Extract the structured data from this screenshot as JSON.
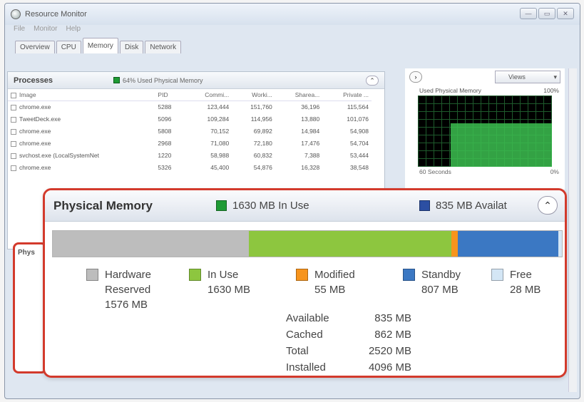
{
  "window": {
    "title": "Resource Monitor",
    "btn_min": "—",
    "btn_max": "▭",
    "btn_close": "✕"
  },
  "menu": [
    "File",
    "Monitor",
    "Help"
  ],
  "tabs": [
    "Overview",
    "CPU",
    "Memory",
    "Disk",
    "Network"
  ],
  "active_tab": "Memory",
  "processes": {
    "title": "Processes",
    "summary": "64% Used Physical Memory",
    "columns": [
      "Image",
      "PID",
      "Commi...",
      "Worki...",
      "Sharea...",
      "Private ..."
    ],
    "rows": [
      [
        "chrome.exe",
        "5288",
        "123,444",
        "151,760",
        "36,196",
        "115,564"
      ],
      [
        "TweetDeck.exe",
        "5096",
        "109,284",
        "114,956",
        "13,880",
        "101,076"
      ],
      [
        "chrome.exe",
        "5808",
        "70,152",
        "69,892",
        "14,984",
        "54,908"
      ],
      [
        "chrome.exe",
        "2968",
        "71,080",
        "72,180",
        "17,476",
        "54,704"
      ],
      [
        "svchost.exe (LocalSystemNet",
        "1220",
        "58,988",
        "60,832",
        "7,388",
        "53,444"
      ],
      [
        "chrome.exe",
        "5326",
        "45,400",
        "54,876",
        "16,328",
        "38,548"
      ]
    ]
  },
  "graph": {
    "label": "Used Physical Memory",
    "max": "100%",
    "foot_left": "60 Seconds",
    "foot_right": "0%",
    "views_label": "Views",
    "used_fraction": 0.64
  },
  "physical": {
    "behind_label": "Phys",
    "title": "Physical Memory",
    "in_use_header": "1630 MB In Use",
    "available_header": "835 MB Availat",
    "legend": [
      {
        "name": "Hardware",
        "name2": "Reserved",
        "value": "1576 MB",
        "color": "#bdbdbd"
      },
      {
        "name": "In Use",
        "name2": "",
        "value": "1630 MB",
        "color": "#8dc63f"
      },
      {
        "name": "Modified",
        "name2": "",
        "value": "55 MB",
        "color": "#f7941d"
      },
      {
        "name": "Standby",
        "name2": "",
        "value": "807 MB",
        "color": "#3b78c3"
      },
      {
        "name": "Free",
        "name2": "",
        "value": "28 MB",
        "color": "#d4e6f5"
      }
    ],
    "bar_mb": {
      "hardware": 1576,
      "in_use": 1630,
      "modified": 55,
      "standby": 807,
      "free": 28
    },
    "stats": [
      {
        "label": "Available",
        "value": "835 MB"
      },
      {
        "label": "Cached",
        "value": "862 MB"
      },
      {
        "label": "Total",
        "value": "2520 MB"
      },
      {
        "label": "Installed",
        "value": "4096 MB"
      }
    ]
  }
}
